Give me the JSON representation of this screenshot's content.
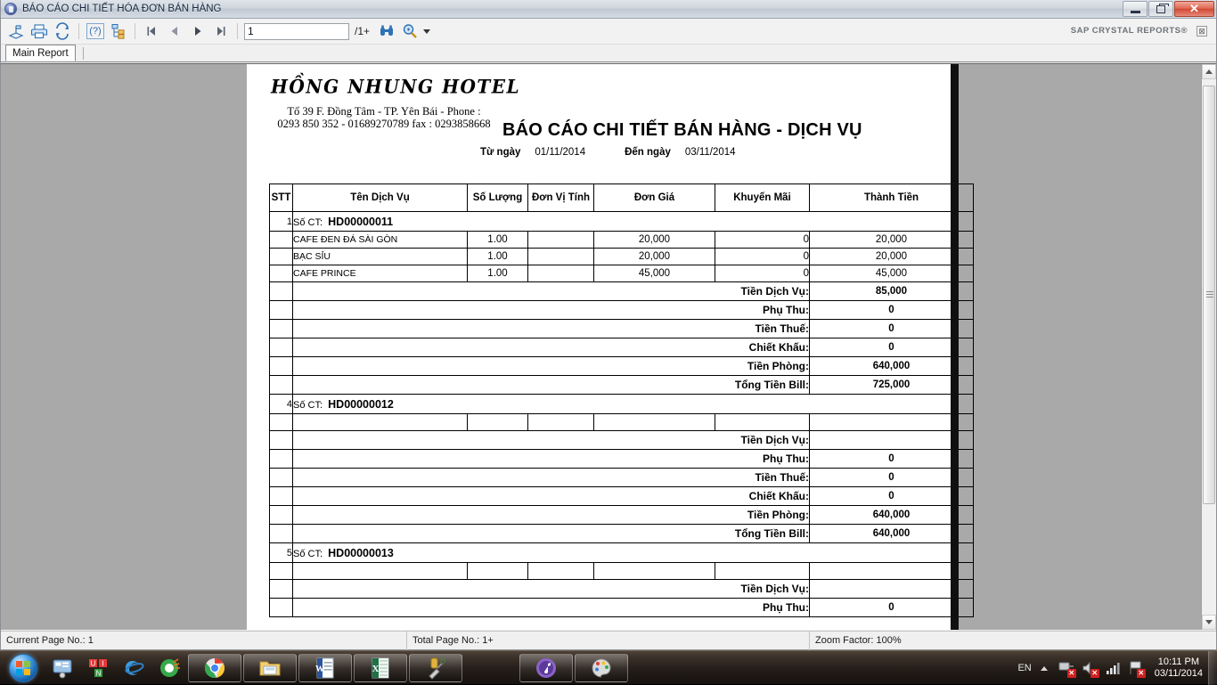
{
  "window": {
    "title": "BÁO CÁO CHI TIẾT HÓA ĐƠN BÁN HÀNG",
    "minimize_label": "Minimize",
    "maximize_label": "Restore",
    "close_label": "✕"
  },
  "toolbar": {
    "export_label": "Export",
    "print_label": "Print",
    "refresh_label": "Refresh",
    "help_label": "(?)",
    "group_tree_label": "Toggle Group Tree",
    "first_page_label": "First Page",
    "prev_page_label": "Previous Page",
    "next_page_label": "Next Page",
    "last_page_label": "Last Page",
    "page_value": "1",
    "page_placeholder": "",
    "page_total": "/1+",
    "find_label": "Find Text",
    "zoom_label": "Zoom",
    "brand": "SAP CRYSTAL REPORTS®",
    "brand_close": "⊠"
  },
  "tabs": {
    "main_report": "Main Report"
  },
  "report": {
    "hotel_name": "HỒNG NHUNG HOTEL",
    "address_line1": "Tổ 39 F. Đồng Tâm - TP. Yên Bái - Phone :",
    "address_line2": "0293 850 352 - 01689270789 fax : 0293858668",
    "title": "BÁO CÁO CHI TIẾT BÁN HÀNG - DỊCH VỤ",
    "from_label": "Từ ngày",
    "from_date": "01/11/2014",
    "to_label": "Đến ngày",
    "to_date": "03/11/2014",
    "columns": [
      "STT",
      "Tên Dịch Vụ",
      "Số Lượng",
      "Đơn Vị Tính",
      "Đơn Giá",
      "Khuyến Mãi",
      "Thành Tiền"
    ],
    "invoice_prefix": "Số CT:",
    "blocks": [
      {
        "stt": "1",
        "invoice_no": "HD00000011",
        "items": [
          {
            "name": "CAFE ĐEN ĐÁ SÀI GÒN",
            "qty": "1.00",
            "unit": "",
            "price": "20,000",
            "promo": "0",
            "total": "20,000"
          },
          {
            "name": "BẠC SỈU",
            "qty": "1.00",
            "unit": "",
            "price": "20,000",
            "promo": "0",
            "total": "20,000"
          },
          {
            "name": "CAFE PRINCE",
            "qty": "1.00",
            "unit": "",
            "price": "45,000",
            "promo": "0",
            "total": "45,000"
          }
        ],
        "summary": [
          {
            "label": "Tiền Dịch Vụ:",
            "value": "85,000"
          },
          {
            "label": "Phụ Thu:",
            "value": "0"
          },
          {
            "label": "Tiền Thuế:",
            "value": "0"
          },
          {
            "label": "Chiết Khấu:",
            "value": "0"
          },
          {
            "label": "Tiền Phòng:",
            "value": "640,000"
          },
          {
            "label": "Tổng Tiền Bill:",
            "value": "725,000"
          }
        ]
      },
      {
        "stt": "4",
        "invoice_no": "HD00000012",
        "items": [
          {
            "name": "",
            "qty": "",
            "unit": "",
            "price": "",
            "promo": "",
            "total": ""
          }
        ],
        "summary": [
          {
            "label": "Tiền Dịch Vụ:",
            "value": ""
          },
          {
            "label": "Phụ Thu:",
            "value": "0"
          },
          {
            "label": "Tiền Thuế:",
            "value": "0"
          },
          {
            "label": "Chiết Khấu:",
            "value": "0"
          },
          {
            "label": "Tiền Phòng:",
            "value": "640,000"
          },
          {
            "label": "Tổng Tiền Bill:",
            "value": "640,000"
          }
        ]
      },
      {
        "stt": "5",
        "invoice_no": "HD00000013",
        "items": [
          {
            "name": "",
            "qty": "",
            "unit": "",
            "price": "",
            "promo": "",
            "total": ""
          }
        ],
        "summary": [
          {
            "label": "Tiền Dịch Vụ:",
            "value": ""
          },
          {
            "label": "Phụ Thu:",
            "value": "0"
          }
        ]
      }
    ]
  },
  "status_bar": {
    "current_page": "Current Page No.: 1",
    "total_page": "Total Page No.: 1+",
    "zoom_factor": "Zoom Factor: 100%"
  },
  "taskbar": {
    "start_label": "Start",
    "language": "EN",
    "time": "10:11 PM",
    "date": "03/11/2014",
    "items": [
      "quick-launch-media",
      "quick-launch-unikey",
      "quick-launch-ie",
      "quick-launch-app",
      "chrome-window",
      "explorer-window",
      "word-window",
      "excel-window",
      "tools-window",
      "visualstudio-window",
      "itunes-window",
      "paint-window"
    ]
  }
}
